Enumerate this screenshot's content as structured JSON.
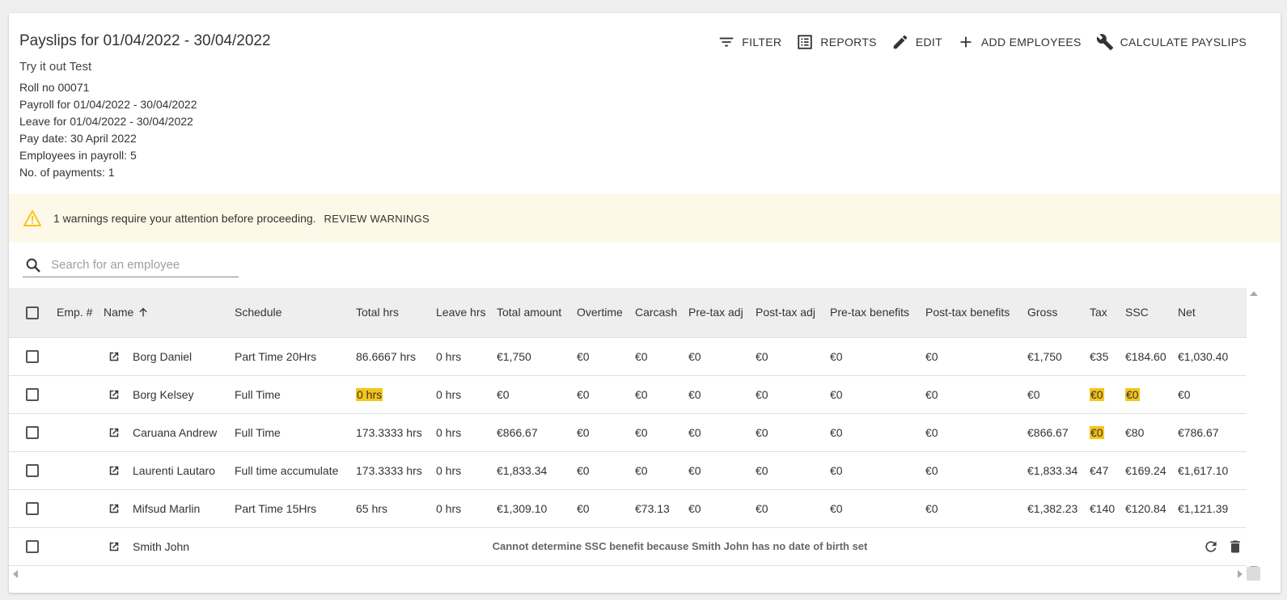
{
  "header": {
    "title": "Payslips for 01/04/2022 - 30/04/2022",
    "subtitle": "Try it out Test",
    "info": [
      "Roll no 00071",
      "Payroll for 01/04/2022 - 30/04/2022",
      "Leave for 01/04/2022 - 30/04/2022",
      "Pay date: 30 April 2022",
      "Employees in payroll: 5",
      "No. of payments: 1"
    ]
  },
  "toolbar": {
    "filter": "FILTER",
    "reports": "REPORTS",
    "edit": "EDIT",
    "add_employees": "ADD EMPLOYEES",
    "calculate": "CALCULATE PAYSLIPS"
  },
  "warning": {
    "text": "1 warnings require your attention before proceeding.",
    "action": "REVIEW WARNINGS",
    "color": "#fdf8e7",
    "icon_color": "#f5c518"
  },
  "search": {
    "placeholder": "Search for an employee",
    "value": ""
  },
  "table": {
    "columns": [
      "Emp. #",
      "Name",
      "Schedule",
      "Total hrs",
      "Leave hrs",
      "Total amount",
      "Overtime",
      "Carcash",
      "Pre-tax adj",
      "Post-tax adj",
      "Pre-tax benefits",
      "Post-tax benefits",
      "Gross",
      "Tax",
      "SSC",
      "Net"
    ],
    "rows": [
      {
        "emp": "",
        "name": "Borg Daniel",
        "schedule": "Part Time 20Hrs",
        "total_hrs": "86.6667 hrs",
        "leave_hrs": "0 hrs",
        "total_amount": "€1,750",
        "overtime": "€0",
        "carcash": "€0",
        "pre_tax_adj": "€0",
        "post_tax_adj": "€0",
        "pre_tax_benefits": "€0",
        "post_tax_benefits": "€0",
        "gross": "€1,750",
        "tax": "€35",
        "ssc": "€184.60",
        "net": "€1,030.40"
      },
      {
        "emp": "",
        "name": "Borg Kelsey",
        "schedule": "Full Time",
        "total_hrs": "0 hrs",
        "leave_hrs": "0 hrs",
        "total_amount": "€0",
        "overtime": "€0",
        "carcash": "€0",
        "pre_tax_adj": "€0",
        "post_tax_adj": "€0",
        "pre_tax_benefits": "€0",
        "post_tax_benefits": "€0",
        "gross": "€0",
        "tax": "€0",
        "ssc": "€0",
        "net": "€0"
      },
      {
        "emp": "",
        "name": "Caruana Andrew",
        "schedule": "Full Time",
        "total_hrs": "173.3333 hrs",
        "leave_hrs": "0 hrs",
        "total_amount": "€866.67",
        "overtime": "€0",
        "carcash": "€0",
        "pre_tax_adj": "€0",
        "post_tax_adj": "€0",
        "pre_tax_benefits": "€0",
        "post_tax_benefits": "€0",
        "gross": "€866.67",
        "tax": "€0",
        "ssc": "€80",
        "net": "€786.67"
      },
      {
        "emp": "",
        "name": "Laurenti Lautaro",
        "schedule": "Full time accumulate",
        "total_hrs": "173.3333 hrs",
        "leave_hrs": "0 hrs",
        "total_amount": "€1,833.34",
        "overtime": "€0",
        "carcash": "€0",
        "pre_tax_adj": "€0",
        "post_tax_adj": "€0",
        "pre_tax_benefits": "€0",
        "post_tax_benefits": "€0",
        "gross": "€1,833.34",
        "tax": "€47",
        "ssc": "€169.24",
        "net": "€1,617.10"
      },
      {
        "emp": "",
        "name": "Mifsud Marlin",
        "schedule": "Part Time 15Hrs",
        "total_hrs": "65 hrs",
        "leave_hrs": "0 hrs",
        "total_amount": "€1,309.10",
        "overtime": "€0",
        "carcash": "€73.13",
        "pre_tax_adj": "€0",
        "post_tax_adj": "€0",
        "pre_tax_benefits": "€0",
        "post_tax_benefits": "€0",
        "gross": "€1,382.23",
        "tax": "€140",
        "ssc": "€120.84",
        "net": "€1,121.39"
      }
    ],
    "error_row": {
      "name": "Smith John",
      "message": "Cannot determine SSC benefit because Smith John has no date of birth set"
    },
    "highlight_color": "#f5c518"
  }
}
